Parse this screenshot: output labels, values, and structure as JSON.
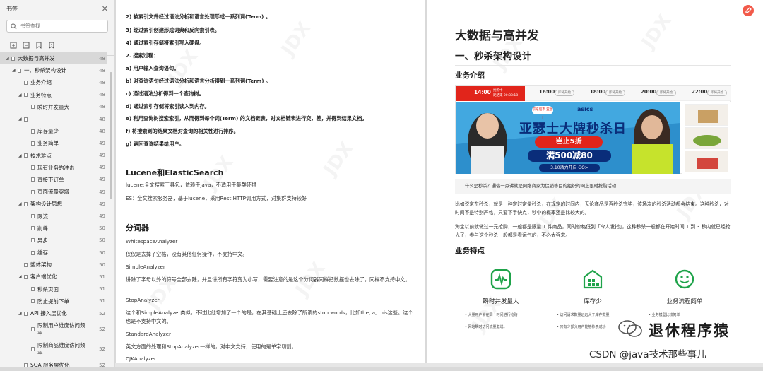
{
  "sidebar": {
    "title": "书签",
    "search_placeholder": "书签查找",
    "toc": [
      {
        "label": "大数据与高并发",
        "page": "48",
        "level": 0,
        "arrow": true,
        "selected": true
      },
      {
        "label": "一、秒杀架构设计",
        "page": "48",
        "level": 1,
        "arrow": true
      },
      {
        "label": "业务介绍",
        "page": "48",
        "level": 2
      },
      {
        "label": "业务特点",
        "page": "48",
        "level": 2,
        "arrow": true
      },
      {
        "label": "瞬时并发量大",
        "page": "48",
        "level": 3
      },
      {
        "label": "",
        "page": "48",
        "level": 2,
        "arrow": true
      },
      {
        "label": "库存量少",
        "page": "48",
        "level": 3
      },
      {
        "label": "业务简单",
        "page": "49",
        "level": 3
      },
      {
        "label": "技术难点",
        "page": "49",
        "level": 2,
        "arrow": true
      },
      {
        "label": "现有业务的冲击",
        "page": "49",
        "level": 3
      },
      {
        "label": "直接下订单",
        "page": "49",
        "level": 3
      },
      {
        "label": "页面流量突增",
        "page": "49",
        "level": 3
      },
      {
        "label": "架构设计思想",
        "page": "49",
        "level": 2,
        "arrow": true
      },
      {
        "label": "限流",
        "page": "49",
        "level": 3
      },
      {
        "label": "削峰",
        "page": "50",
        "level": 3
      },
      {
        "label": "异步",
        "page": "50",
        "level": 3
      },
      {
        "label": "缓存",
        "page": "50",
        "level": 3
      },
      {
        "label": "整体架构",
        "page": "50",
        "level": 2
      },
      {
        "label": "客户端优化",
        "page": "51",
        "level": 2,
        "arrow": true
      },
      {
        "label": "秒杀页面",
        "page": "51",
        "level": 3
      },
      {
        "label": "防止提前下单",
        "page": "51",
        "level": 3
      },
      {
        "label": "API 接入层优化",
        "page": "52",
        "level": 2,
        "arrow": true
      },
      {
        "label": "限制用户维度访问频率",
        "page": "52",
        "level": 3,
        "two": true
      },
      {
        "label": "限制商品维度访问频率",
        "page": "52",
        "level": 3,
        "two": true
      },
      {
        "label": "SOA 服务层优化",
        "page": "52",
        "level": 2
      }
    ]
  },
  "left_page": {
    "steps": [
      "2) 被索引文件经过语法分析和语言处理形成一系列词(Term) 。",
      "3) 经过索引创建形成词典和反向索引表。",
      "4) 通过索引存储将索引写入硬盘。",
      "2. 搜索过程：",
      "a) 用户输入查询语句。",
      "b) 对查询语句经过语法分析和语言分析得到一系列词(Term) 。",
      "c) 通过语法分析得到一个查询树。",
      "d) 通过索引存储将索引读入到内存。",
      "e) 利用查询树搜索索引，从而得到每个词(Term) 的文档链表，对文档链表进行交，差，并得到结果文档。",
      "f) 将搜索到的结果文档对查询的相关性进行排序。",
      "g) 返回查询结果给用户。"
    ],
    "h_lucene": "Lucene和ElasticSearch",
    "p_lucene": "lucene:全文搜索工具包，依赖于java，不适用于集群环境",
    "p_es": "ES：全文搜索服务器，基于lucene，采用Rest HTTP调用方式，对集群支持较好",
    "h_analyzer": "分词器",
    "analyzers": [
      {
        "name": "WhitespaceAnalyzer",
        "desc": "仅仅是去掉了空格，没有其他任何操作，不支持中文。"
      },
      {
        "name": "SimpleAnalyzer",
        "desc": "讲除了字母以外的符号全部去除，并且讲所有字符变为小写，需要注意的是这个分词器同样把数据也去除了，同样不支持中文。"
      },
      {
        "name": "StopAnalyzer",
        "desc": "这个和SimpleAnalyzer类似，不过比他增加了一个的是，在其基础上还去除了所谓的stop words，比如the, a, this这些。这个也是不支持中文的。"
      },
      {
        "name": "StandardAnalyzer",
        "desc": "英文方面的处理和StopAnalyzer一样的，对中文支持，使用的是单字切割。"
      },
      {
        "name": "CJKAnalyzer",
        "desc": ""
      }
    ]
  },
  "right_page": {
    "h1": "大数据与高并发",
    "h2": "一、秒杀架构设计",
    "h3_intro": "业务介绍",
    "banner": {
      "now_time": "14:00",
      "now_status": "抢购中",
      "now_sub": "距结束 00:38:18",
      "slots": [
        {
          "time": "16:00",
          "label": "即将开始"
        },
        {
          "time": "18:00",
          "label": "即将开始"
        },
        {
          "time": "20:00",
          "label": "即将开始"
        },
        {
          "time": "22:00",
          "label": "即将开始"
        }
      ],
      "badge": "京东超市 亚瑟士",
      "brand": "asics",
      "title": "亚瑟士大牌秒杀日",
      "pill1": "岂止5折",
      "pill2": "满500减80",
      "pill3": "3.10活力开启 GO>"
    },
    "caption": "什么是秒杀？通俗一点讲就是网络商家为促销等目的组织的网上限时抢购活动",
    "p1": "比如说京东秒杀，就是一种定时定量秒杀，在规定的时间内，无论商品是否秒杀完毕，该场次的秒杀活动都会结束。这种秒杀，对时间不是特别严格，只要下手快点，秒中的概率还是比较大的。",
    "p2": "淘宝以前就做过一元抢购，一般都是限量 1 件商品，同时价格低到「令人发指」，这种秒杀一般都在开始时间 1 到 3 秒内就已经抢光了，参与这个秒杀一般都是看运气的，不必太强求。",
    "h3_feat": "业务特点",
    "features": [
      {
        "title": "瞬时并发量大",
        "items": [
          "大量用户会在同一时间进行抢购",
          "网站瞬时访问流量激增。"
        ]
      },
      {
        "title": "库存少",
        "items": [
          "访问请求数量远远大于库存数量",
          "只有少部分用户能够秒杀成功"
        ]
      },
      {
        "title": "业务流程简单",
        "items": [
          "业务模型比较简单",
          ""
        ]
      }
    ]
  },
  "watermark": "JDX",
  "overlay": {
    "line1": "退休程序猿",
    "line2": "CSDN @java技术那些事儿"
  },
  "colors": {
    "accent_red": "#e1251b",
    "feature_green": "#1fa34a",
    "banner_blue": "#0a2d7a",
    "fab": "#f25a4a"
  }
}
